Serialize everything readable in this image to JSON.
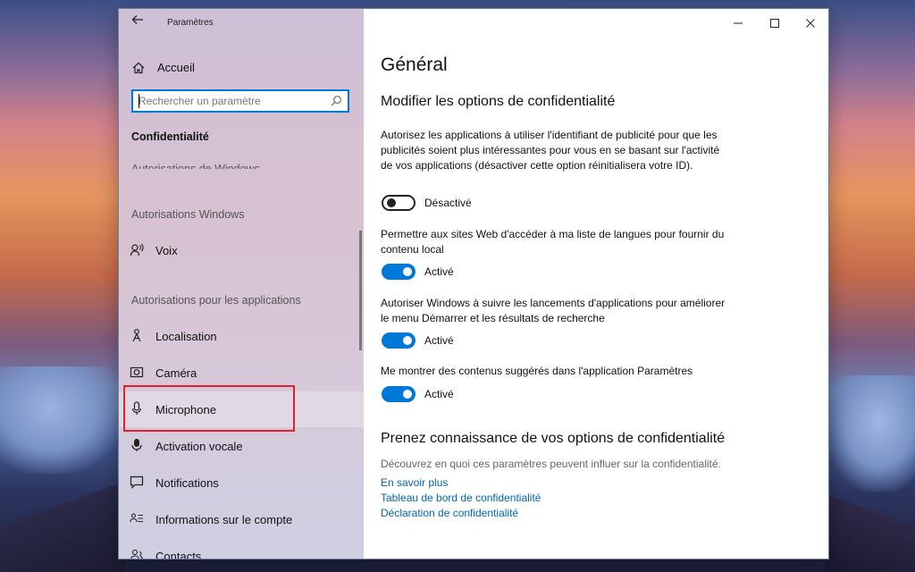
{
  "window": {
    "app_title": "Paramètres"
  },
  "sidebar": {
    "home_label": "Accueil",
    "search_placeholder": "Rechercher un paramètre",
    "section_title": "Confidentialité",
    "cut_heading": "Autorisations de Windows",
    "groups": [
      "Autorisations Windows",
      "Autorisations pour les applications"
    ],
    "items": [
      {
        "label": "Voix",
        "icon": "speech-icon"
      },
      {
        "label": "Localisation",
        "icon": "location-icon"
      },
      {
        "label": "Caméra",
        "icon": "camera-icon"
      },
      {
        "label": "Microphone",
        "icon": "microphone-icon",
        "selected": true
      },
      {
        "label": "Activation vocale",
        "icon": "voice-activation-icon"
      },
      {
        "label": "Notifications",
        "icon": "notifications-icon"
      },
      {
        "label": "Informations sur le compte",
        "icon": "account-info-icon"
      },
      {
        "label": "Contacts",
        "icon": "contacts-icon"
      }
    ]
  },
  "main": {
    "page_title": "Général",
    "section1_title": "Modifier les options de confidentialité",
    "settings": [
      {
        "text": "Autorisez les applications à utiliser l'identifiant de publicité pour que les publicités soient plus intéressantes pour vous en se basant sur l'activité de vos applications (désactiver cette option réinitialisera votre ID).",
        "state": "Désactivé",
        "on": false
      },
      {
        "text": "Permettre aux sites Web d'accéder à ma liste de langues pour fournir du contenu local",
        "state": "Activé",
        "on": true
      },
      {
        "text": "Autoriser Windows à suivre les lancements d'applications pour améliorer le menu Démarrer et les résultats de recherche",
        "state": "Activé",
        "on": true
      },
      {
        "text": "Me montrer des contenus suggérés dans l'application Paramètres",
        "state": "Activé",
        "on": true
      }
    ],
    "section2_title": "Prenez connaissance de vos options de confidentialité",
    "section2_desc": "Découvrez en quoi ces paramètres peuvent influer sur la confidentialité.",
    "links": [
      "En savoir plus",
      "Tableau de bord de confidentialité",
      "Déclaration de confidentialité"
    ]
  },
  "colors": {
    "accent": "#0078d7",
    "highlight_box": "#e0202a",
    "link": "#0066b4"
  }
}
